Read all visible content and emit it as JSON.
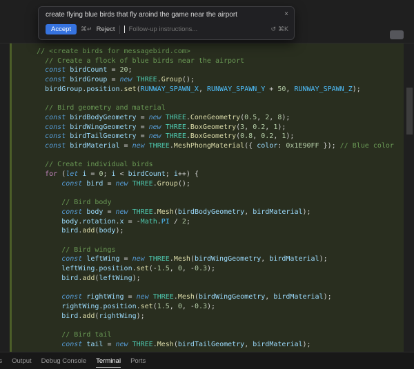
{
  "popup": {
    "prompt": "create flying blue birds that fly aroind the game near the airport",
    "close_icon": "×",
    "accept_label": "Accept",
    "accept_keys": "⌘↵",
    "reject_label": "Reject",
    "followup_placeholder": "Follow-up instructions...",
    "history_icon": "↺",
    "followup_keys": "⌘K"
  },
  "panel": {
    "tabs": [
      {
        "label": "Problems",
        "active": false,
        "clipped": true
      },
      {
        "label": "Output",
        "active": false
      },
      {
        "label": "Debug Console",
        "active": false
      },
      {
        "label": "Terminal",
        "active": true
      },
      {
        "label": "Ports",
        "active": false
      }
    ]
  },
  "colors": {
    "accent_blue": "#3673e0",
    "added_line_bg": "#292e1f",
    "added_gutter": "#4c5e28",
    "comment": "#6A9955",
    "keyword": "#569CD6",
    "control": "#C586C0",
    "variable": "#9CDCFE",
    "constant": "#4FC1FF",
    "class": "#4EC9B0",
    "function": "#DCDCAA",
    "number": "#B5CEA8",
    "default_text": "#d4d4d4"
  },
  "code": {
    "lines": [
      {
        "i": 4,
        "t": [
          [
            "cm",
            "// <create birds for messagebird.com>"
          ]
        ]
      },
      {
        "i": 6,
        "t": [
          [
            "cm",
            "// Create a flock of blue birds near the airport"
          ]
        ]
      },
      {
        "i": 6,
        "t": [
          [
            "kw",
            "const "
          ],
          [
            "v",
            "birdCount"
          ],
          [
            "p",
            " = "
          ],
          [
            "n",
            "20"
          ],
          [
            "p",
            ";"
          ]
        ]
      },
      {
        "i": 6,
        "t": [
          [
            "kw",
            "const "
          ],
          [
            "v",
            "birdGroup"
          ],
          [
            "p",
            " = "
          ],
          [
            "kw",
            "new "
          ],
          [
            "cl",
            "THREE"
          ],
          [
            "p",
            "."
          ],
          [
            "fn",
            "Group"
          ],
          [
            "p",
            "();"
          ]
        ]
      },
      {
        "i": 6,
        "t": [
          [
            "v",
            "birdGroup"
          ],
          [
            "p",
            "."
          ],
          [
            "v",
            "position"
          ],
          [
            "p",
            "."
          ],
          [
            "fn",
            "set"
          ],
          [
            "p",
            "("
          ],
          [
            "cc",
            "RUNWAY_SPAWN_X"
          ],
          [
            "p",
            ", "
          ],
          [
            "cc",
            "RUNWAY_SPAWN_Y"
          ],
          [
            "p",
            " + "
          ],
          [
            "n",
            "50"
          ],
          [
            "p",
            ", "
          ],
          [
            "cc",
            "RUNWAY_SPAWN_Z"
          ],
          [
            "p",
            ");"
          ]
        ]
      },
      {
        "i": 0,
        "t": []
      },
      {
        "i": 6,
        "t": [
          [
            "cm",
            "// Bird geometry and material"
          ]
        ]
      },
      {
        "i": 6,
        "t": [
          [
            "kw",
            "const "
          ],
          [
            "v",
            "birdBodyGeometry"
          ],
          [
            "p",
            " = "
          ],
          [
            "kw",
            "new "
          ],
          [
            "cl",
            "THREE"
          ],
          [
            "p",
            "."
          ],
          [
            "fn",
            "ConeGeometry"
          ],
          [
            "p",
            "("
          ],
          [
            "n",
            "0.5"
          ],
          [
            "p",
            ", "
          ],
          [
            "n",
            "2"
          ],
          [
            "p",
            ", "
          ],
          [
            "n",
            "8"
          ],
          [
            "p",
            ");"
          ]
        ]
      },
      {
        "i": 6,
        "t": [
          [
            "kw",
            "const "
          ],
          [
            "v",
            "birdWingGeometry"
          ],
          [
            "p",
            " = "
          ],
          [
            "kw",
            "new "
          ],
          [
            "cl",
            "THREE"
          ],
          [
            "p",
            "."
          ],
          [
            "fn",
            "BoxGeometry"
          ],
          [
            "p",
            "("
          ],
          [
            "n",
            "3"
          ],
          [
            "p",
            ", "
          ],
          [
            "n",
            "0.2"
          ],
          [
            "p",
            ", "
          ],
          [
            "n",
            "1"
          ],
          [
            "p",
            ");"
          ]
        ]
      },
      {
        "i": 6,
        "t": [
          [
            "kw",
            "const "
          ],
          [
            "v",
            "birdTailGeometry"
          ],
          [
            "p",
            " = "
          ],
          [
            "kw",
            "new "
          ],
          [
            "cl",
            "THREE"
          ],
          [
            "p",
            "."
          ],
          [
            "fn",
            "BoxGeometry"
          ],
          [
            "p",
            "("
          ],
          [
            "n",
            "0.8"
          ],
          [
            "p",
            ", "
          ],
          [
            "n",
            "0.2"
          ],
          [
            "p",
            ", "
          ],
          [
            "n",
            "1"
          ],
          [
            "p",
            ");"
          ]
        ]
      },
      {
        "i": 6,
        "t": [
          [
            "kw",
            "const "
          ],
          [
            "v",
            "birdMaterial"
          ],
          [
            "p",
            " = "
          ],
          [
            "kw",
            "new "
          ],
          [
            "cl",
            "THREE"
          ],
          [
            "p",
            "."
          ],
          [
            "fn",
            "MeshPhongMaterial"
          ],
          [
            "p",
            "({ "
          ],
          [
            "v",
            "color"
          ],
          [
            "p",
            ": "
          ],
          [
            "n",
            "0x1E90FF"
          ],
          [
            "p",
            " }); "
          ],
          [
            "cm",
            "// Blue color"
          ]
        ]
      },
      {
        "i": 0,
        "t": []
      },
      {
        "i": 6,
        "t": [
          [
            "cm",
            "// Create individual birds"
          ]
        ]
      },
      {
        "i": 6,
        "t": [
          [
            "ct",
            "for "
          ],
          [
            "p",
            "("
          ],
          [
            "kw",
            "let "
          ],
          [
            "v",
            "i"
          ],
          [
            "p",
            " = "
          ],
          [
            "n",
            "0"
          ],
          [
            "p",
            "; "
          ],
          [
            "v",
            "i"
          ],
          [
            "p",
            " < "
          ],
          [
            "v",
            "birdCount"
          ],
          [
            "p",
            "; "
          ],
          [
            "v",
            "i"
          ],
          [
            "p",
            "++) {"
          ]
        ]
      },
      {
        "i": 10,
        "t": [
          [
            "kw",
            "const "
          ],
          [
            "v",
            "bird"
          ],
          [
            "p",
            " = "
          ],
          [
            "kw",
            "new "
          ],
          [
            "cl",
            "THREE"
          ],
          [
            "p",
            "."
          ],
          [
            "fn",
            "Group"
          ],
          [
            "p",
            "();"
          ]
        ]
      },
      {
        "i": 0,
        "t": []
      },
      {
        "i": 10,
        "t": [
          [
            "cm",
            "// Bird body"
          ]
        ]
      },
      {
        "i": 10,
        "t": [
          [
            "kw",
            "const "
          ],
          [
            "v",
            "body"
          ],
          [
            "p",
            " = "
          ],
          [
            "kw",
            "new "
          ],
          [
            "cl",
            "THREE"
          ],
          [
            "p",
            "."
          ],
          [
            "fn",
            "Mesh"
          ],
          [
            "p",
            "("
          ],
          [
            "v",
            "birdBodyGeometry"
          ],
          [
            "p",
            ", "
          ],
          [
            "v",
            "birdMaterial"
          ],
          [
            "p",
            ");"
          ]
        ]
      },
      {
        "i": 10,
        "t": [
          [
            "v",
            "body"
          ],
          [
            "p",
            "."
          ],
          [
            "v",
            "rotation"
          ],
          [
            "p",
            "."
          ],
          [
            "v",
            "x"
          ],
          [
            "p",
            " = -"
          ],
          [
            "cl",
            "Math"
          ],
          [
            "p",
            "."
          ],
          [
            "cc",
            "PI"
          ],
          [
            "p",
            " / "
          ],
          [
            "n",
            "2"
          ],
          [
            "p",
            ";"
          ]
        ]
      },
      {
        "i": 10,
        "t": [
          [
            "v",
            "bird"
          ],
          [
            "p",
            "."
          ],
          [
            "fn",
            "add"
          ],
          [
            "p",
            "("
          ],
          [
            "v",
            "body"
          ],
          [
            "p",
            ");"
          ]
        ]
      },
      {
        "i": 0,
        "t": []
      },
      {
        "i": 10,
        "t": [
          [
            "cm",
            "// Bird wings"
          ]
        ]
      },
      {
        "i": 10,
        "t": [
          [
            "kw",
            "const "
          ],
          [
            "v",
            "leftWing"
          ],
          [
            "p",
            " = "
          ],
          [
            "kw",
            "new "
          ],
          [
            "cl",
            "THREE"
          ],
          [
            "p",
            "."
          ],
          [
            "fn",
            "Mesh"
          ],
          [
            "p",
            "("
          ],
          [
            "v",
            "birdWingGeometry"
          ],
          [
            "p",
            ", "
          ],
          [
            "v",
            "birdMaterial"
          ],
          [
            "p",
            ");"
          ]
        ]
      },
      {
        "i": 10,
        "t": [
          [
            "v",
            "leftWing"
          ],
          [
            "p",
            "."
          ],
          [
            "v",
            "position"
          ],
          [
            "p",
            "."
          ],
          [
            "fn",
            "set"
          ],
          [
            "p",
            "(-"
          ],
          [
            "n",
            "1.5"
          ],
          [
            "p",
            ", "
          ],
          [
            "n",
            "0"
          ],
          [
            "p",
            ", -"
          ],
          [
            "n",
            "0.3"
          ],
          [
            "p",
            ");"
          ]
        ]
      },
      {
        "i": 10,
        "t": [
          [
            "v",
            "bird"
          ],
          [
            "p",
            "."
          ],
          [
            "fn",
            "add"
          ],
          [
            "p",
            "("
          ],
          [
            "v",
            "leftWing"
          ],
          [
            "p",
            ");"
          ]
        ]
      },
      {
        "i": 0,
        "t": []
      },
      {
        "i": 10,
        "t": [
          [
            "kw",
            "const "
          ],
          [
            "v",
            "rightWing"
          ],
          [
            "p",
            " = "
          ],
          [
            "kw",
            "new "
          ],
          [
            "cl",
            "THREE"
          ],
          [
            "p",
            "."
          ],
          [
            "fn",
            "Mesh"
          ],
          [
            "p",
            "("
          ],
          [
            "v",
            "birdWingGeometry"
          ],
          [
            "p",
            ", "
          ],
          [
            "v",
            "birdMaterial"
          ],
          [
            "p",
            ");"
          ]
        ]
      },
      {
        "i": 10,
        "t": [
          [
            "v",
            "rightWing"
          ],
          [
            "p",
            "."
          ],
          [
            "v",
            "position"
          ],
          [
            "p",
            "."
          ],
          [
            "fn",
            "set"
          ],
          [
            "p",
            "("
          ],
          [
            "n",
            "1.5"
          ],
          [
            "p",
            ", "
          ],
          [
            "n",
            "0"
          ],
          [
            "p",
            ", -"
          ],
          [
            "n",
            "0.3"
          ],
          [
            "p",
            ");"
          ]
        ]
      },
      {
        "i": 10,
        "t": [
          [
            "v",
            "bird"
          ],
          [
            "p",
            "."
          ],
          [
            "fn",
            "add"
          ],
          [
            "p",
            "("
          ],
          [
            "v",
            "rightWing"
          ],
          [
            "p",
            ");"
          ]
        ]
      },
      {
        "i": 0,
        "t": []
      },
      {
        "i": 10,
        "t": [
          [
            "cm",
            "// Bird tail"
          ]
        ]
      },
      {
        "i": 10,
        "t": [
          [
            "kw",
            "const "
          ],
          [
            "v",
            "tail"
          ],
          [
            "p",
            " = "
          ],
          [
            "kw",
            "new "
          ],
          [
            "cl",
            "THREE"
          ],
          [
            "p",
            "."
          ],
          [
            "fn",
            "Mesh"
          ],
          [
            "p",
            "("
          ],
          [
            "v",
            "birdTailGeometry"
          ],
          [
            "p",
            ", "
          ],
          [
            "v",
            "birdMaterial"
          ],
          [
            "p",
            ");"
          ]
        ]
      }
    ]
  }
}
